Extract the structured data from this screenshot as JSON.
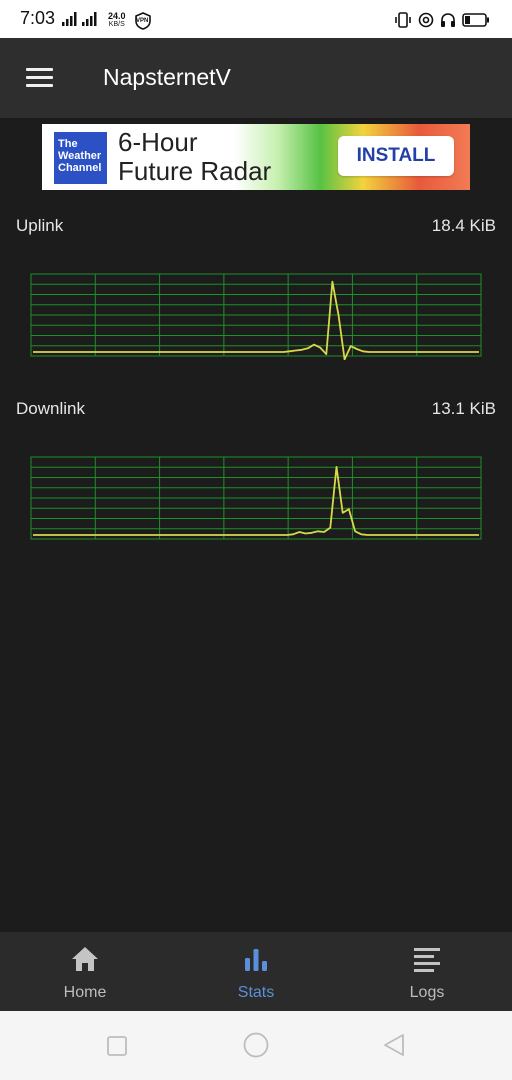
{
  "status_bar": {
    "time": "7:03",
    "net_speed_value": "24.0",
    "net_speed_unit": "KB/S",
    "vpn_label": "VPN",
    "icons": [
      "signal-icon",
      "signal-lte-icon",
      "vpn-icon",
      "vibrate-icon",
      "at-sign-icon",
      "headphones-icon",
      "battery-icon"
    ]
  },
  "app_bar": {
    "title": "NapsternetV",
    "menu_icon": "hamburger-menu-icon"
  },
  "ad": {
    "logo_line1": "The",
    "logo_line2": "Weather",
    "logo_line3": "Channel",
    "headline_line1": "6-Hour",
    "headline_line2": "Future Radar",
    "button": "INSTALL"
  },
  "stats": {
    "uplink_label": "Uplink",
    "uplink_value": "18.4 KiB",
    "downlink_label": "Downlink",
    "downlink_value": "13.1 KiB"
  },
  "bottom_nav": {
    "items": [
      {
        "label": "Home",
        "icon": "home-icon",
        "active": false
      },
      {
        "label": "Stats",
        "icon": "bar-chart-icon",
        "active": true
      },
      {
        "label": "Logs",
        "icon": "logs-lines-icon",
        "active": false
      }
    ]
  },
  "colors": {
    "background": "#1c1c1c",
    "app_bar": "#2e2e2e",
    "grid": "#1f8f2a",
    "trace": "#d8d84a",
    "active_nav": "#5b8fd9"
  },
  "chart_data": [
    {
      "type": "line",
      "series": [
        {
          "values": [
            0,
            0,
            0,
            0,
            0,
            0,
            0,
            0,
            0,
            0,
            0,
            0,
            0,
            0,
            0,
            0,
            0,
            0,
            0,
            0,
            0,
            0,
            0,
            0,
            0,
            0,
            0,
            0,
            0,
            0,
            0,
            0,
            0,
            0,
            0,
            0,
            0,
            0,
            0,
            0,
            0,
            0,
            0.01,
            0.02,
            0.03,
            0.05,
            0.1,
            0.06,
            -0.03,
            0.95,
            0.5,
            -0.1,
            0.08,
            0.04,
            0.01,
            0,
            0,
            0,
            0,
            0,
            0,
            0,
            0,
            0,
            0,
            0,
            0,
            0,
            0,
            0,
            0,
            0,
            0,
            0
          ]
        }
      ],
      "ylim": [
        -0.2,
        1
      ],
      "grid": true
    },
    {
      "type": "line",
      "series": [
        {
          "values": [
            0,
            0,
            0,
            0,
            0,
            0,
            0,
            0,
            0,
            0,
            0,
            0,
            0,
            0,
            0,
            0,
            0,
            0,
            0,
            0,
            0,
            0,
            0,
            0,
            0,
            0,
            0,
            0,
            0,
            0,
            0,
            0,
            0,
            0,
            0,
            0,
            0,
            0,
            0,
            0,
            0,
            0,
            0.01,
            0.04,
            0.02,
            0.03,
            0.05,
            0.04,
            0.1,
            0.92,
            0.3,
            0.35,
            0.05,
            0.01,
            0,
            0,
            0,
            0,
            0,
            0,
            0,
            0,
            0,
            0,
            0,
            0,
            0,
            0,
            0,
            0,
            0,
            0,
            0
          ]
        }
      ],
      "ylim": [
        -0.2,
        1
      ],
      "grid": true
    }
  ]
}
